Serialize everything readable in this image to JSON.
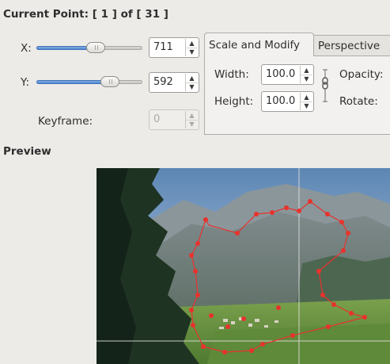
{
  "header": {
    "prefix": "Current Point: [",
    "current": "1",
    "of_text": "] of [",
    "total": "31",
    "suffix": "]"
  },
  "x_row": {
    "label": "X:",
    "value": "711",
    "slider_fraction": 0.57
  },
  "y_row": {
    "label": "Y:",
    "value": "592",
    "slider_fraction": 0.74
  },
  "keyframe": {
    "label": "Keyframe:",
    "value": "0"
  },
  "tabs": [
    {
      "label": "Scale and Modify",
      "active": true
    },
    {
      "label": "Perspective",
      "active": false
    }
  ],
  "scale": {
    "width_label": "Width:",
    "width_value": "100.0",
    "height_label": "Height:",
    "height_value": "100.0",
    "opacity_label": "Opacity:",
    "rotate_label": "Rotate:"
  },
  "preview_label": "Preview",
  "colors": {
    "accent": "#4f86cf",
    "path": "#e8322c",
    "background": "#ecebe8"
  },
  "icons": {
    "spin_up": "▲",
    "spin_down": "▼",
    "chain": "chain-link-icon"
  }
}
